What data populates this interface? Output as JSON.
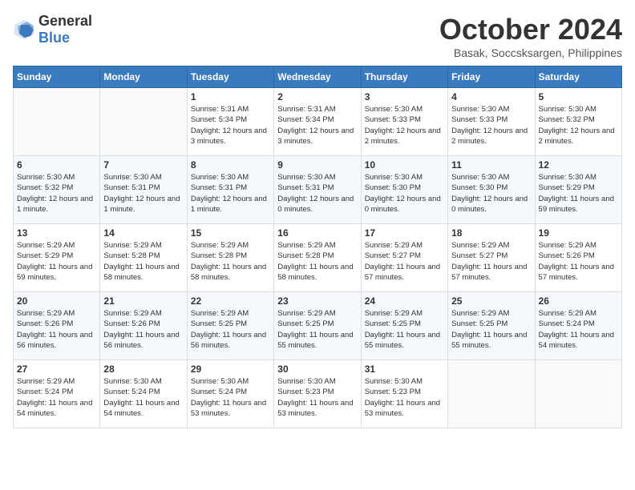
{
  "header": {
    "logo_general": "General",
    "logo_blue": "Blue",
    "month": "October 2024",
    "location": "Basak, Soccsksargen, Philippines"
  },
  "days_of_week": [
    "Sunday",
    "Monday",
    "Tuesday",
    "Wednesday",
    "Thursday",
    "Friday",
    "Saturday"
  ],
  "weeks": [
    [
      {
        "day": "",
        "empty": true
      },
      {
        "day": "",
        "empty": true
      },
      {
        "day": "1",
        "sunrise": "Sunrise: 5:31 AM",
        "sunset": "Sunset: 5:34 PM",
        "daylight": "Daylight: 12 hours and 3 minutes."
      },
      {
        "day": "2",
        "sunrise": "Sunrise: 5:31 AM",
        "sunset": "Sunset: 5:34 PM",
        "daylight": "Daylight: 12 hours and 3 minutes."
      },
      {
        "day": "3",
        "sunrise": "Sunrise: 5:30 AM",
        "sunset": "Sunset: 5:33 PM",
        "daylight": "Daylight: 12 hours and 2 minutes."
      },
      {
        "day": "4",
        "sunrise": "Sunrise: 5:30 AM",
        "sunset": "Sunset: 5:33 PM",
        "daylight": "Daylight: 12 hours and 2 minutes."
      },
      {
        "day": "5",
        "sunrise": "Sunrise: 5:30 AM",
        "sunset": "Sunset: 5:32 PM",
        "daylight": "Daylight: 12 hours and 2 minutes."
      }
    ],
    [
      {
        "day": "6",
        "sunrise": "Sunrise: 5:30 AM",
        "sunset": "Sunset: 5:32 PM",
        "daylight": "Daylight: 12 hours and 1 minute."
      },
      {
        "day": "7",
        "sunrise": "Sunrise: 5:30 AM",
        "sunset": "Sunset: 5:31 PM",
        "daylight": "Daylight: 12 hours and 1 minute."
      },
      {
        "day": "8",
        "sunrise": "Sunrise: 5:30 AM",
        "sunset": "Sunset: 5:31 PM",
        "daylight": "Daylight: 12 hours and 1 minute."
      },
      {
        "day": "9",
        "sunrise": "Sunrise: 5:30 AM",
        "sunset": "Sunset: 5:31 PM",
        "daylight": "Daylight: 12 hours and 0 minutes."
      },
      {
        "day": "10",
        "sunrise": "Sunrise: 5:30 AM",
        "sunset": "Sunset: 5:30 PM",
        "daylight": "Daylight: 12 hours and 0 minutes."
      },
      {
        "day": "11",
        "sunrise": "Sunrise: 5:30 AM",
        "sunset": "Sunset: 5:30 PM",
        "daylight": "Daylight: 12 hours and 0 minutes."
      },
      {
        "day": "12",
        "sunrise": "Sunrise: 5:30 AM",
        "sunset": "Sunset: 5:29 PM",
        "daylight": "Daylight: 11 hours and 59 minutes."
      }
    ],
    [
      {
        "day": "13",
        "sunrise": "Sunrise: 5:29 AM",
        "sunset": "Sunset: 5:29 PM",
        "daylight": "Daylight: 11 hours and 59 minutes."
      },
      {
        "day": "14",
        "sunrise": "Sunrise: 5:29 AM",
        "sunset": "Sunset: 5:28 PM",
        "daylight": "Daylight: 11 hours and 58 minutes."
      },
      {
        "day": "15",
        "sunrise": "Sunrise: 5:29 AM",
        "sunset": "Sunset: 5:28 PM",
        "daylight": "Daylight: 11 hours and 58 minutes."
      },
      {
        "day": "16",
        "sunrise": "Sunrise: 5:29 AM",
        "sunset": "Sunset: 5:28 PM",
        "daylight": "Daylight: 11 hours and 58 minutes."
      },
      {
        "day": "17",
        "sunrise": "Sunrise: 5:29 AM",
        "sunset": "Sunset: 5:27 PM",
        "daylight": "Daylight: 11 hours and 57 minutes."
      },
      {
        "day": "18",
        "sunrise": "Sunrise: 5:29 AM",
        "sunset": "Sunset: 5:27 PM",
        "daylight": "Daylight: 11 hours and 57 minutes."
      },
      {
        "day": "19",
        "sunrise": "Sunrise: 5:29 AM",
        "sunset": "Sunset: 5:26 PM",
        "daylight": "Daylight: 11 hours and 57 minutes."
      }
    ],
    [
      {
        "day": "20",
        "sunrise": "Sunrise: 5:29 AM",
        "sunset": "Sunset: 5:26 PM",
        "daylight": "Daylight: 11 hours and 56 minutes."
      },
      {
        "day": "21",
        "sunrise": "Sunrise: 5:29 AM",
        "sunset": "Sunset: 5:26 PM",
        "daylight": "Daylight: 11 hours and 56 minutes."
      },
      {
        "day": "22",
        "sunrise": "Sunrise: 5:29 AM",
        "sunset": "Sunset: 5:25 PM",
        "daylight": "Daylight: 11 hours and 56 minutes."
      },
      {
        "day": "23",
        "sunrise": "Sunrise: 5:29 AM",
        "sunset": "Sunset: 5:25 PM",
        "daylight": "Daylight: 11 hours and 55 minutes."
      },
      {
        "day": "24",
        "sunrise": "Sunrise: 5:29 AM",
        "sunset": "Sunset: 5:25 PM",
        "daylight": "Daylight: 11 hours and 55 minutes."
      },
      {
        "day": "25",
        "sunrise": "Sunrise: 5:29 AM",
        "sunset": "Sunset: 5:25 PM",
        "daylight": "Daylight: 11 hours and 55 minutes."
      },
      {
        "day": "26",
        "sunrise": "Sunrise: 5:29 AM",
        "sunset": "Sunset: 5:24 PM",
        "daylight": "Daylight: 11 hours and 54 minutes."
      }
    ],
    [
      {
        "day": "27",
        "sunrise": "Sunrise: 5:29 AM",
        "sunset": "Sunset: 5:24 PM",
        "daylight": "Daylight: 11 hours and 54 minutes."
      },
      {
        "day": "28",
        "sunrise": "Sunrise: 5:30 AM",
        "sunset": "Sunset: 5:24 PM",
        "daylight": "Daylight: 11 hours and 54 minutes."
      },
      {
        "day": "29",
        "sunrise": "Sunrise: 5:30 AM",
        "sunset": "Sunset: 5:24 PM",
        "daylight": "Daylight: 11 hours and 53 minutes."
      },
      {
        "day": "30",
        "sunrise": "Sunrise: 5:30 AM",
        "sunset": "Sunset: 5:23 PM",
        "daylight": "Daylight: 11 hours and 53 minutes."
      },
      {
        "day": "31",
        "sunrise": "Sunrise: 5:30 AM",
        "sunset": "Sunset: 5:23 PM",
        "daylight": "Daylight: 11 hours and 53 minutes."
      },
      {
        "day": "",
        "empty": true
      },
      {
        "day": "",
        "empty": true
      }
    ]
  ]
}
